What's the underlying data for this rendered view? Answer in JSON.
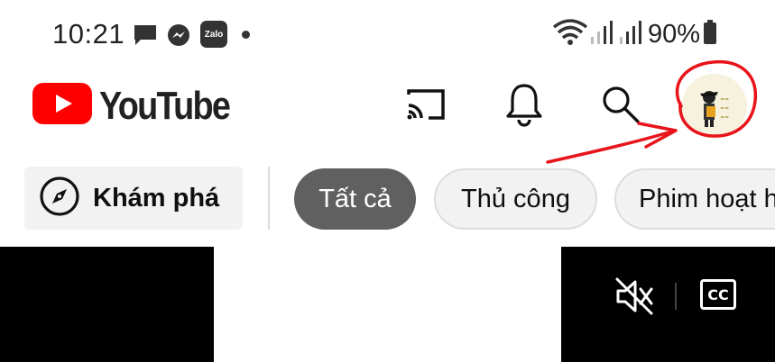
{
  "status_bar": {
    "time": "10:21",
    "notification_icons": [
      "message-icon",
      "messenger-icon",
      "zalo-icon",
      "dot-icon"
    ],
    "zalo_label": "Zalo",
    "battery": "90%",
    "signal_icons": [
      "wifi-icon",
      "signal-icon",
      "signal-icon",
      "battery-icon"
    ]
  },
  "header": {
    "logo_text": "YouTube",
    "brand_color": "#ff0000",
    "actions": [
      "cast-icon",
      "bell-icon",
      "search-icon",
      "avatar"
    ]
  },
  "chips": {
    "explore_label": "Khám phá",
    "items": [
      {
        "label": "Tất cả",
        "active": true
      },
      {
        "label": "Thủ công",
        "active": false
      },
      {
        "label": "Phim hoạt h",
        "active": false
      }
    ]
  },
  "player": {
    "controls": [
      "mute-icon",
      "cc-icon"
    ],
    "cc_label": "CC"
  },
  "annotation": {
    "color": "#e8141b",
    "shapes": [
      "circle-around-avatar",
      "arrow-to-avatar"
    ]
  }
}
